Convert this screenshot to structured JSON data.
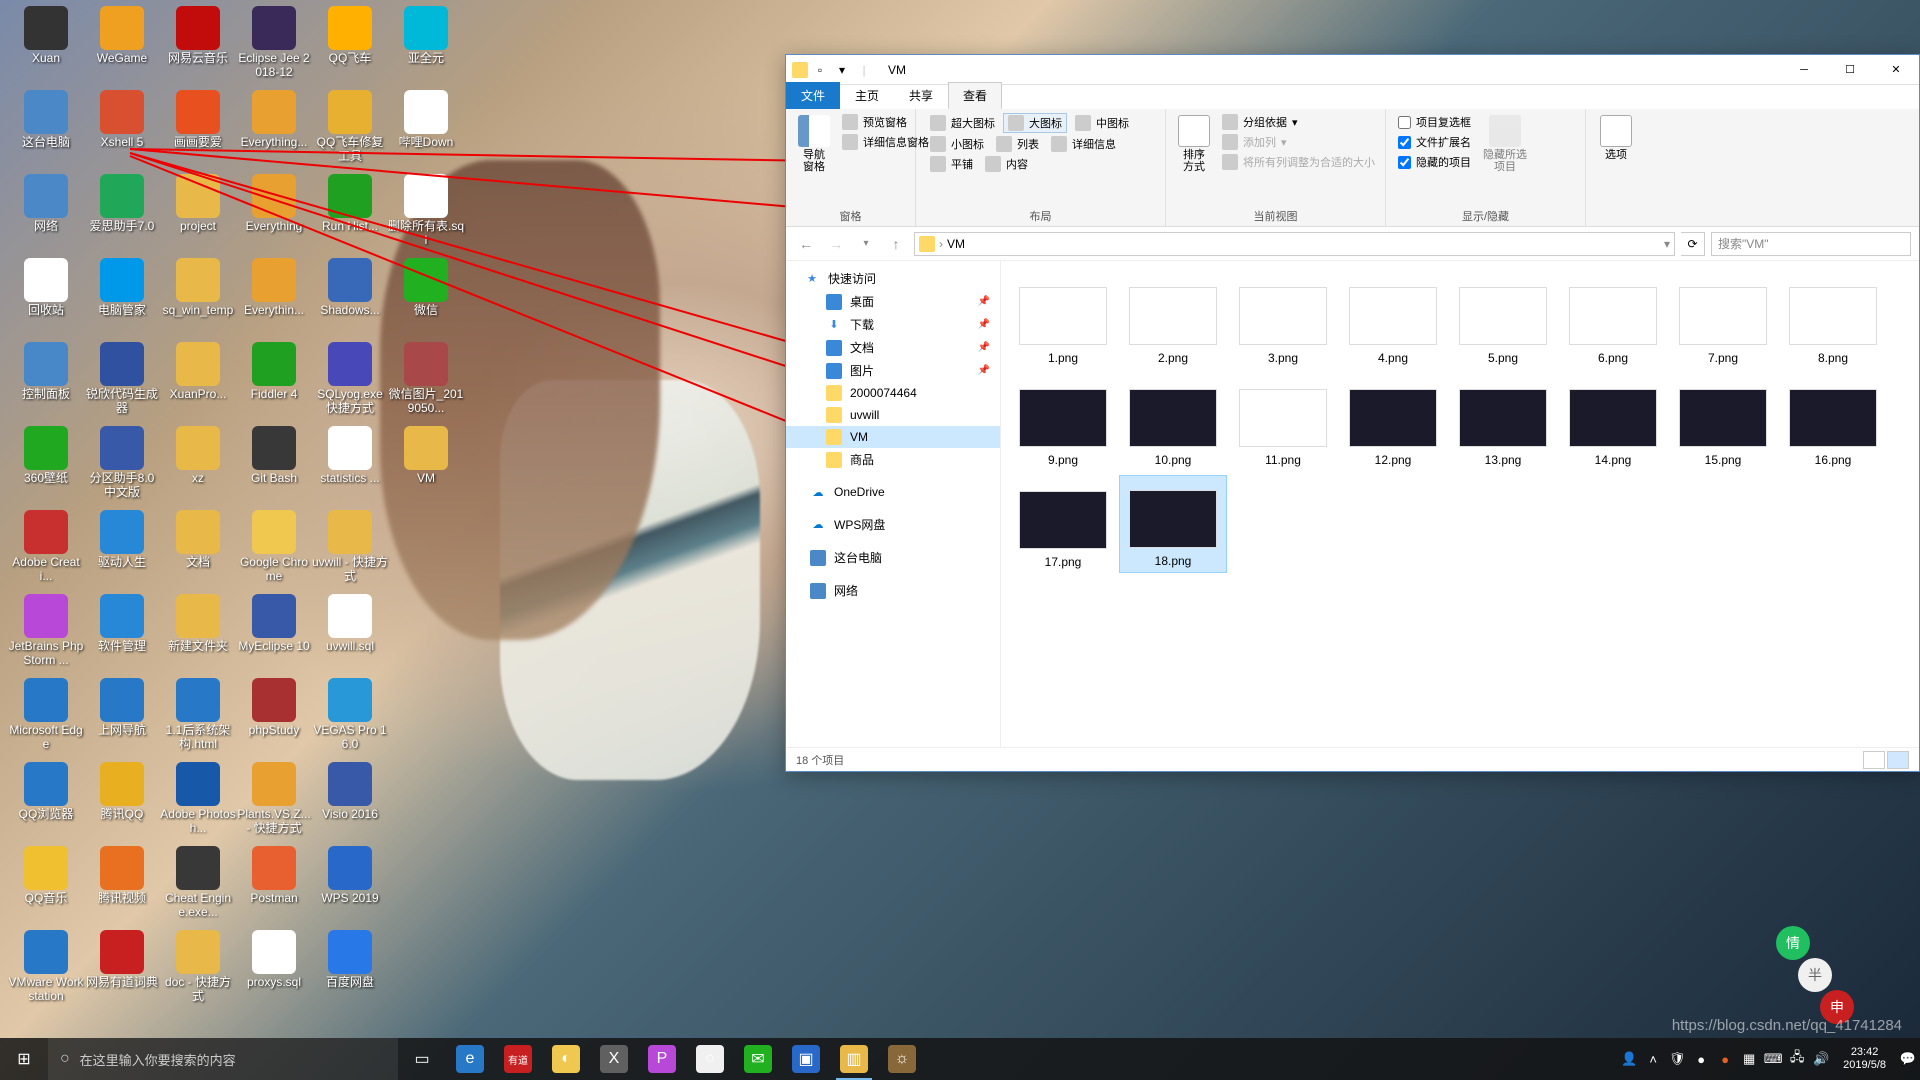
{
  "desktop_icons": [
    {
      "label": "Xuan",
      "col": 0,
      "row": 0,
      "bg": "#333"
    },
    {
      "label": "WeGame",
      "col": 1,
      "row": 0,
      "bg": "#f0a020"
    },
    {
      "label": "网易云音乐",
      "col": 2,
      "row": 0,
      "bg": "#c20c0c"
    },
    {
      "label": "Eclipse Jee 2018-12",
      "col": 3,
      "row": 0,
      "bg": "#3a2a5a"
    },
    {
      "label": "QQ飞车",
      "col": 4,
      "row": 0,
      "bg": "#ffb000"
    },
    {
      "label": "亚全元",
      "col": 5,
      "row": 0,
      "bg": "#00b8d8"
    },
    {
      "label": "这台电脑",
      "col": 0,
      "row": 1,
      "bg": "#4a88c8"
    },
    {
      "label": "Xshell 5",
      "col": 1,
      "row": 1,
      "bg": "#d85030"
    },
    {
      "label": "画画要爱",
      "col": 2,
      "row": 1,
      "bg": "#e85020"
    },
    {
      "label": "Everything...",
      "col": 3,
      "row": 1,
      "bg": "#e8a030"
    },
    {
      "label": "QQ飞车修复工具",
      "col": 4,
      "row": 1,
      "bg": "#e8b030"
    },
    {
      "label": "哔哩Down",
      "col": 5,
      "row": 1,
      "bg": "#fff"
    },
    {
      "label": "网络",
      "col": 0,
      "row": 2,
      "bg": "#4a88c8"
    },
    {
      "label": "爱思助手7.0",
      "col": 1,
      "row": 2,
      "bg": "#20a858"
    },
    {
      "label": "project",
      "col": 2,
      "row": 2,
      "bg": "#e8b848"
    },
    {
      "label": "Everything",
      "col": 3,
      "row": 2,
      "bg": "#e8a030"
    },
    {
      "label": "Run Hist...",
      "col": 4,
      "row": 2,
      "bg": "#20a020"
    },
    {
      "label": "删除所有表.sql",
      "col": 5,
      "row": 2,
      "bg": "#fff"
    },
    {
      "label": "回收站",
      "col": 0,
      "row": 3,
      "bg": "#fff"
    },
    {
      "label": "电脑管家",
      "col": 1,
      "row": 3,
      "bg": "#0098e8"
    },
    {
      "label": "sq_win_temp",
      "col": 2,
      "row": 3,
      "bg": "#e8b848"
    },
    {
      "label": "Everythin...",
      "col": 3,
      "row": 3,
      "bg": "#e8a030"
    },
    {
      "label": "Shadows...",
      "col": 4,
      "row": 3,
      "bg": "#3868b8"
    },
    {
      "label": "微信",
      "col": 5,
      "row": 3,
      "bg": "#20b020"
    },
    {
      "label": "控制面板",
      "col": 0,
      "row": 4,
      "bg": "#4888c8"
    },
    {
      "label": "锐欣代码生成器",
      "col": 1,
      "row": 4,
      "bg": "#3050a0"
    },
    {
      "label": "XuanPro...",
      "col": 2,
      "row": 4,
      "bg": "#e8b848"
    },
    {
      "label": "Fiddler 4",
      "col": 3,
      "row": 4,
      "bg": "#20a020"
    },
    {
      "label": "SQLyog.exe 快捷方式",
      "col": 4,
      "row": 4,
      "bg": "#4848b8"
    },
    {
      "label": "微信图片_2019050...",
      "col": 5,
      "row": 4,
      "bg": "#a84848"
    },
    {
      "label": "360壁纸",
      "col": 0,
      "row": 5,
      "bg": "#20a820"
    },
    {
      "label": "分区助手8.0中文版",
      "col": 1,
      "row": 5,
      "bg": "#3858a8"
    },
    {
      "label": "xz",
      "col": 2,
      "row": 5,
      "bg": "#e8b848"
    },
    {
      "label": "Git Bash",
      "col": 3,
      "row": 5,
      "bg": "#383838"
    },
    {
      "label": "statistics ...",
      "col": 4,
      "row": 5,
      "bg": "#fff"
    },
    {
      "label": "VM",
      "col": 5,
      "row": 5,
      "bg": "#e8b848"
    },
    {
      "label": "Adobe Creati...",
      "col": 0,
      "row": 6,
      "bg": "#c83030"
    },
    {
      "label": "驱动人生",
      "col": 1,
      "row": 6,
      "bg": "#2888d8"
    },
    {
      "label": "文档",
      "col": 2,
      "row": 6,
      "bg": "#e8b848"
    },
    {
      "label": "Google Chrome",
      "col": 3,
      "row": 6,
      "bg": "#f0c850"
    },
    {
      "label": "uvwill - 快捷方式",
      "col": 4,
      "row": 6,
      "bg": "#e8b848"
    },
    {
      "label": "JetBrains PhpStorm ...",
      "col": 0,
      "row": 7,
      "bg": "#b848d8"
    },
    {
      "label": "软件管理",
      "col": 1,
      "row": 7,
      "bg": "#2888d8"
    },
    {
      "label": "新建文件夹",
      "col": 2,
      "row": 7,
      "bg": "#e8b848"
    },
    {
      "label": "MyEclipse 10",
      "col": 3,
      "row": 7,
      "bg": "#3858a8"
    },
    {
      "label": "uvwill.sql",
      "col": 4,
      "row": 7,
      "bg": "#fff"
    },
    {
      "label": "Microsoft Edge",
      "col": 0,
      "row": 8,
      "bg": "#2878c8"
    },
    {
      "label": "上网导航",
      "col": 1,
      "row": 8,
      "bg": "#2878c8"
    },
    {
      "label": "1.1后系统架构.html",
      "col": 2,
      "row": 8,
      "bg": "#2878c8"
    },
    {
      "label": "phpStudy",
      "col": 3,
      "row": 8,
      "bg": "#a83030"
    },
    {
      "label": "VEGAS Pro 16.0",
      "col": 4,
      "row": 8,
      "bg": "#2898d8"
    },
    {
      "label": "QQ浏览器",
      "col": 0,
      "row": 9,
      "bg": "#2878c8"
    },
    {
      "label": "腾讯QQ",
      "col": 1,
      "row": 9,
      "bg": "#e8b020"
    },
    {
      "label": "Adobe Photosh...",
      "col": 2,
      "row": 9,
      "bg": "#1858a8"
    },
    {
      "label": "Plants.VS.Z... - 快捷方式",
      "col": 3,
      "row": 9,
      "bg": "#e8a030"
    },
    {
      "label": "Visio 2016",
      "col": 4,
      "row": 9,
      "bg": "#3858a8"
    },
    {
      "label": "QQ音乐",
      "col": 0,
      "row": 10,
      "bg": "#f0c030"
    },
    {
      "label": "腾讯视频",
      "col": 1,
      "row": 10,
      "bg": "#e87020"
    },
    {
      "label": "Cheat Engine.exe...",
      "col": 2,
      "row": 10,
      "bg": "#383838"
    },
    {
      "label": "Postman",
      "col": 3,
      "row": 10,
      "bg": "#e86030"
    },
    {
      "label": "WPS 2019",
      "col": 4,
      "row": 10,
      "bg": "#2868c8"
    },
    {
      "label": "VMware Workstation",
      "col": 0,
      "row": 11,
      "bg": "#2878c8"
    },
    {
      "label": "网易有道词典",
      "col": 1,
      "row": 11,
      "bg": "#c82020"
    },
    {
      "label": "doc - 快捷方式",
      "col": 2,
      "row": 11,
      "bg": "#e8b848"
    },
    {
      "label": "proxys.sql",
      "col": 3,
      "row": 11,
      "bg": "#fff"
    },
    {
      "label": "百度网盘",
      "col": 4,
      "row": 11,
      "bg": "#2878e8"
    }
  ],
  "explorer": {
    "title": "VM",
    "tabs": {
      "file": "文件",
      "home": "主页",
      "share": "共享",
      "view": "查看"
    },
    "ribbon": {
      "nav": {
        "pane": "导航窗格",
        "preview": "预览窗格",
        "details": "详细信息窗格",
        "group": "窗格"
      },
      "layout": {
        "xlarge": "超大图标",
        "large": "大图标",
        "medium": "中图标",
        "small": "小图标",
        "list": "列表",
        "details": "详细信息",
        "tiles": "平铺",
        "content": "内容",
        "group": "布局"
      },
      "current": {
        "sort": "排序方式",
        "groupby": "分组依据",
        "addcol": "添加列",
        "fitcol": "将所有列调整为合适的大小",
        "group": "当前视图"
      },
      "showhide": {
        "chk_itembox": "项目复选框",
        "chk_ext": "文件扩展名",
        "chk_hidden": "隐藏的项目",
        "hidesel": "隐藏所选项目",
        "group": "显示/隐藏"
      },
      "options": "选项"
    },
    "address": {
      "path": "VM",
      "search_placeholder": "搜索\"VM\""
    },
    "nav": {
      "quick": "快速访问",
      "desktop": "桌面",
      "downloads": "下载",
      "documents": "文档",
      "pictures": "图片",
      "f1": "2000074464",
      "f2": "uvwill",
      "f3": "VM",
      "f4": "商品",
      "onedrive": "OneDrive",
      "wps": "WPS网盘",
      "thispc": "这台电脑",
      "network": "网络"
    },
    "files": [
      {
        "name": "1.png",
        "dark": false
      },
      {
        "name": "2.png",
        "dark": false
      },
      {
        "name": "3.png",
        "dark": false
      },
      {
        "name": "4.png",
        "dark": false
      },
      {
        "name": "5.png",
        "dark": false
      },
      {
        "name": "6.png",
        "dark": false
      },
      {
        "name": "7.png",
        "dark": false
      },
      {
        "name": "8.png",
        "dark": false
      },
      {
        "name": "9.png",
        "dark": true
      },
      {
        "name": "10.png",
        "dark": true
      },
      {
        "name": "11.png",
        "dark": false
      },
      {
        "name": "12.png",
        "dark": true
      },
      {
        "name": "13.png",
        "dark": true
      },
      {
        "name": "14.png",
        "dark": true
      },
      {
        "name": "15.png",
        "dark": true
      },
      {
        "name": "16.png",
        "dark": true
      },
      {
        "name": "17.png",
        "dark": true
      },
      {
        "name": "18.png",
        "dark": true
      }
    ],
    "status": "18 个项目"
  },
  "taskbar": {
    "search_placeholder": "在这里输入你要搜索的内容",
    "items": [
      {
        "name": "task-view",
        "bg": "transparent",
        "glyph": "▭"
      },
      {
        "name": "edge",
        "bg": "#2878c8",
        "glyph": "e"
      },
      {
        "name": "youdao",
        "bg": "#c82020",
        "glyph": "有道"
      },
      {
        "name": "chrome",
        "bg": "#f0c850",
        "glyph": "◐"
      },
      {
        "name": "xshell",
        "bg": "#606060",
        "glyph": "X"
      },
      {
        "name": "phpstorm",
        "bg": "#b848d8",
        "glyph": "P"
      },
      {
        "name": "app1",
        "bg": "#f0f0f0",
        "glyph": "○"
      },
      {
        "name": "wechat",
        "bg": "#20b020",
        "glyph": "✉"
      },
      {
        "name": "vm",
        "bg": "#2868c8",
        "glyph": "▣"
      },
      {
        "name": "explorer",
        "bg": "#e8b848",
        "glyph": "▥",
        "active": true
      },
      {
        "name": "app2",
        "bg": "#886838",
        "glyph": "☼"
      }
    ],
    "clock": {
      "time": "23:42",
      "date": "2019/5/8"
    }
  },
  "watermark": "https://blog.csdn.net/qq_41741284"
}
